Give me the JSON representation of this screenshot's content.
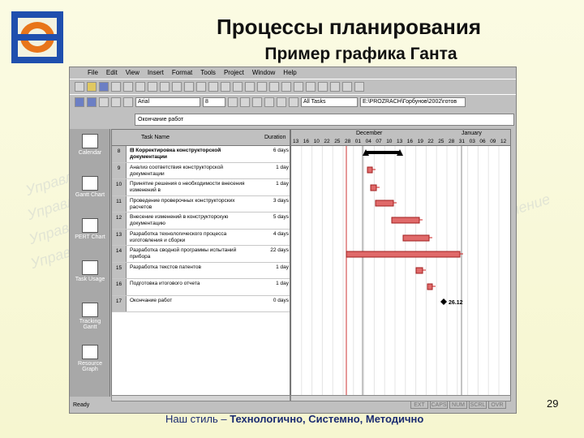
{
  "slide": {
    "title": "Процессы планирования",
    "subtitle": "Пример графика Ганта",
    "footer_prefix": "Наш стиль – ",
    "footer_bold": "Технологично, Системно, Методично",
    "page_number": "29",
    "watermark_text": "Управление"
  },
  "app": {
    "menu": [
      "File",
      "Edit",
      "View",
      "Insert",
      "Format",
      "Tools",
      "Project",
      "Window",
      "Help"
    ],
    "font_combo": "Arial",
    "size_combo": "8",
    "filter_combo": "All Tasks",
    "path_combo": "E:\\PROZRACH\\Горбунов\\2002\\готов",
    "edit_bar": "Окончание работ",
    "status": "Ready",
    "status_indicators": [
      "EXT",
      "CAPS",
      "NUM",
      "SCRL",
      "OVR"
    ]
  },
  "viewbar": [
    "Calendar",
    "Gantt Chart",
    "PERT Chart",
    "Task Usage",
    "Tracking Gantt",
    "Resource Graph"
  ],
  "grid": {
    "headers": {
      "name": "Task Name",
      "duration": "Duration"
    },
    "rows": [
      {
        "id": "8",
        "name": "⊟ Корректировка конструкторской документации",
        "duration": "6 days",
        "summary": true
      },
      {
        "id": "9",
        "name": "Анализ соответствия конструкторской документации",
        "duration": "1 day",
        "summary": false
      },
      {
        "id": "10",
        "name": "Принятие решения о необходимости внесения изменений в",
        "duration": "1 day",
        "summary": false
      },
      {
        "id": "11",
        "name": "Проведение проверочных конструкторских расчетов",
        "duration": "3 days",
        "summary": false
      },
      {
        "id": "12",
        "name": "Внесение изменений в конструкторскую документацию",
        "duration": "5 days",
        "summary": false
      },
      {
        "id": "13",
        "name": "Разработка технологического процесса изготовления и сборки",
        "duration": "4 days",
        "summary": false
      },
      {
        "id": "14",
        "name": "Разработка сводной программы испытаний прибора",
        "duration": "22 days",
        "summary": false
      },
      {
        "id": "15",
        "name": "Разработка текстов патентов",
        "duration": "1 day",
        "summary": false
      },
      {
        "id": "16",
        "name": "Подготовка итогового отчета",
        "duration": "1 day",
        "summary": false
      },
      {
        "id": "17",
        "name": "Окончание работ",
        "duration": "0 days",
        "summary": false
      }
    ]
  },
  "chart": {
    "months": [
      "December",
      "January"
    ],
    "days": [
      "13",
      "16",
      "10",
      "22",
      "25",
      "28",
      "01",
      "04",
      "07",
      "10",
      "13",
      "16",
      "19",
      "22",
      "25",
      "28",
      "31",
      "03",
      "06",
      "09",
      "12"
    ],
    "milestone_label": "26.12"
  }
}
